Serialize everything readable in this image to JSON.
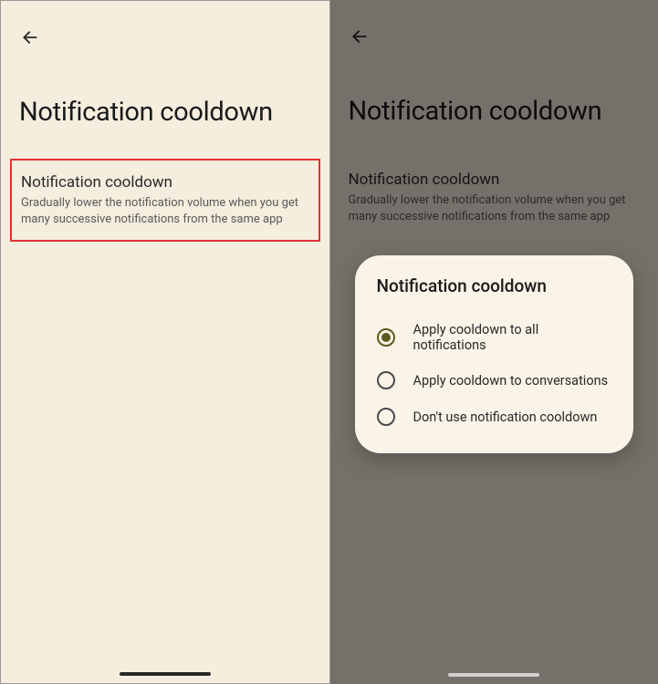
{
  "left": {
    "page_title": "Notification cooldown",
    "setting_title": "Notification cooldown",
    "setting_desc": "Gradually lower the notification volume when you get many successive notifications from the same app"
  },
  "right": {
    "page_title": "Notification cooldown",
    "setting_title": "Notification cooldown",
    "setting_desc": "Gradually lower the notification volume when you get many successive notifications from the same app",
    "dialog": {
      "title": "Notification cooldown",
      "options": {
        "o0": "Apply cooldown to all notifications",
        "o1": "Apply cooldown to conversations",
        "o2": "Don't use notification cooldown"
      },
      "selected_index": 0
    }
  }
}
